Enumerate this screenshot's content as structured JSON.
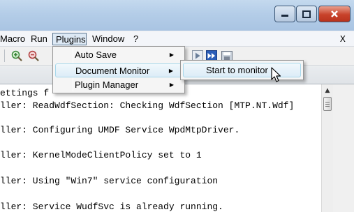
{
  "window": {
    "buttons": {
      "minimize_icon": "minimize-icon",
      "maximize_icon": "maximize-icon",
      "close_icon": "close-icon"
    }
  },
  "menubar": {
    "items": [
      "Macro",
      "Run",
      "Plugins",
      "Window",
      "?"
    ],
    "close_doc": "X"
  },
  "toolbar": {
    "icons": [
      "zoom-in-icon",
      "zoom-out-icon",
      "play-macro-icon",
      "run-macro-multiple-icon",
      "save-macro-icon"
    ]
  },
  "plugins_menu": {
    "items": [
      {
        "label": "Auto Save",
        "submenu_arrow": "▶"
      },
      {
        "label": "Document Monitor",
        "submenu_arrow": "▶",
        "highlighted": true
      },
      {
        "label": "Plugin Manager",
        "submenu_arrow": "▶"
      }
    ]
  },
  "document_monitor_submenu": {
    "items": [
      {
        "label": "Start to monitor",
        "highlighted": true
      }
    ]
  },
  "editor": {
    "lines": [
      "ettings f",
      "ller: ReadWdfSection: Checking WdfSection [MTP.NT.Wdf]",
      "ller: Configuring UMDF Service WpdMtpDriver.",
      "ller: KernelModeClientPolicy set to 1",
      "ller: Using \"Win7\" service configuration",
      "ller: Service WudfSvc is already running."
    ]
  },
  "colors": {
    "titlebar": "#b4cde8",
    "menu_highlight": "#dcecf7",
    "close_button": "#c8422a"
  }
}
